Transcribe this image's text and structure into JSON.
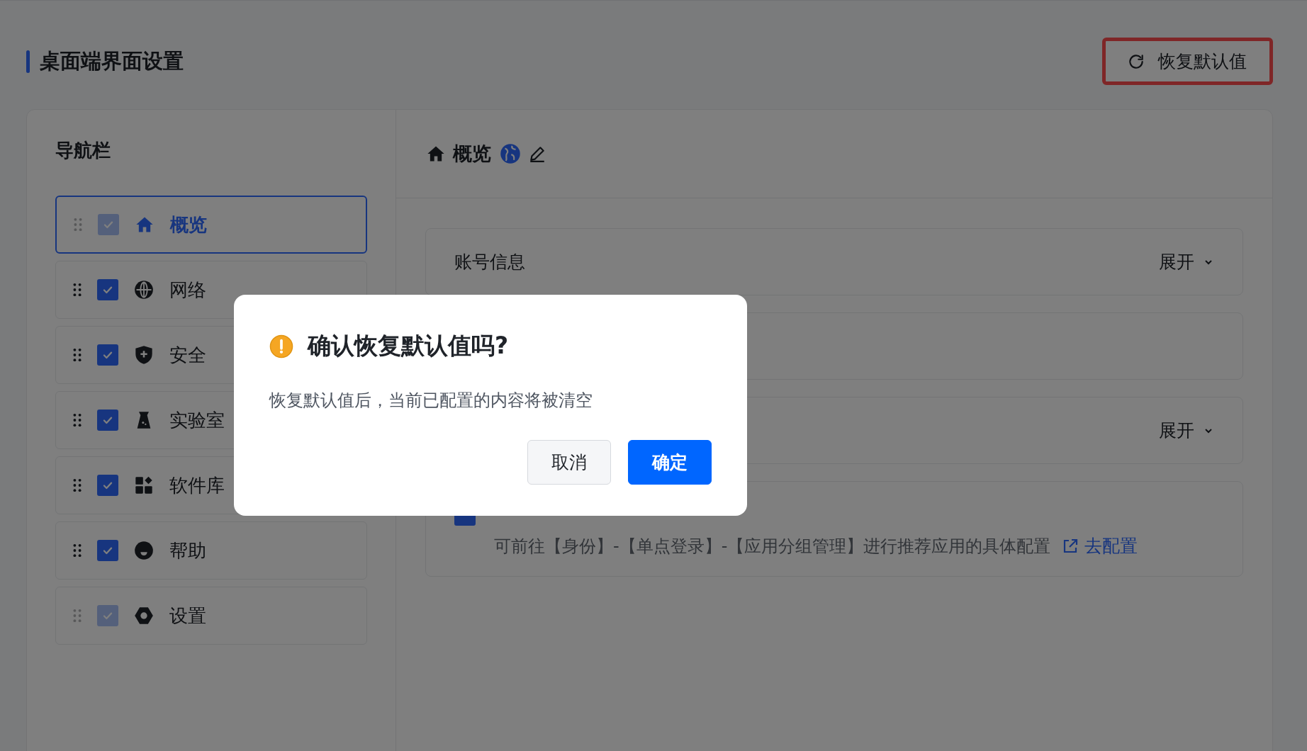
{
  "page": {
    "title": "桌面端界面设置",
    "reset_button": {
      "label": "恢复默认值",
      "highlighted": true
    }
  },
  "nav": {
    "title": "导航栏",
    "items": [
      {
        "label": "概览",
        "checked": true,
        "disabled": true,
        "selected": true
      },
      {
        "label": "网络",
        "checked": true,
        "disabled": false,
        "selected": false
      },
      {
        "label": "安全",
        "checked": true,
        "disabled": false,
        "selected": false
      },
      {
        "label": "实验室",
        "checked": true,
        "disabled": false,
        "selected": false
      },
      {
        "label": "软件库",
        "checked": true,
        "disabled": false,
        "selected": false
      },
      {
        "label": "帮助",
        "checked": true,
        "disabled": false,
        "selected": false
      },
      {
        "label": "设置",
        "checked": true,
        "disabled": true,
        "selected": false
      }
    ]
  },
  "detail": {
    "title": "概览",
    "sections": [
      {
        "kind": "collapsible",
        "title": "账号信息",
        "toggle": "展开"
      },
      {
        "kind": "collapsible"
      },
      {
        "kind": "collapsible",
        "toggle": "展开"
      },
      {
        "kind": "option",
        "checked": true,
        "description": "可前往【身份】-【单点登录】-【应用分组管理】进行推荐应用的具体配置",
        "link": "去配置"
      }
    ]
  },
  "dialog": {
    "title": "确认恢复默认值吗?",
    "message": "恢复默认值后，当前已配置的内容将被清空",
    "buttons": [
      {
        "label": "取消",
        "kind": "secondary"
      },
      {
        "label": "确定",
        "kind": "primary"
      }
    ]
  }
}
